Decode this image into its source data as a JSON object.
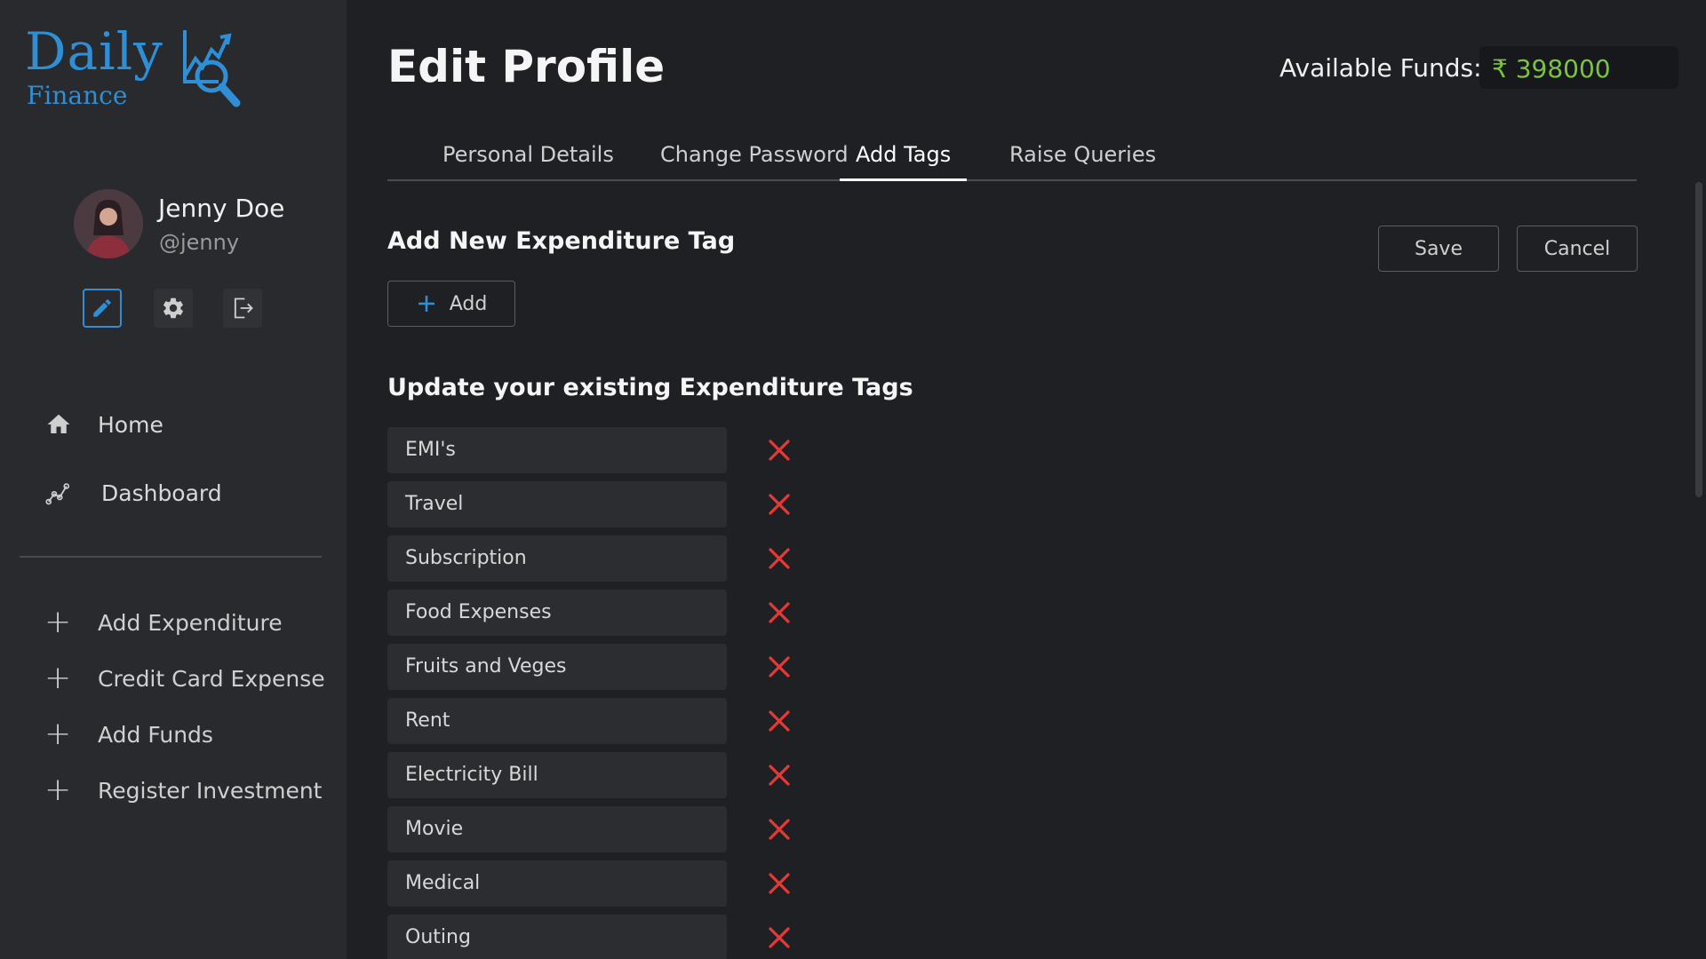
{
  "app": {
    "logo_daily": "Daily",
    "logo_finance": "Finance"
  },
  "user": {
    "name": "Jenny Doe",
    "handle": "@jenny"
  },
  "nav": {
    "home": "Home",
    "dashboard": "Dashboard"
  },
  "actions": [
    {
      "label": "Add Expenditure"
    },
    {
      "label": "Credit Card Expense"
    },
    {
      "label": "Add Funds"
    },
    {
      "label": "Register Investment"
    }
  ],
  "header": {
    "title": "Edit Profile",
    "funds_label": "Available Funds:",
    "funds_value": "₹ 398000"
  },
  "tabs": [
    {
      "label": "Personal Details"
    },
    {
      "label": "Change Password"
    },
    {
      "label": "Add Tags",
      "active": true
    },
    {
      "label": "Raise Queries"
    }
  ],
  "add_section": {
    "title": "Add New Expenditure Tag",
    "add_label": "Add",
    "save_label": "Save",
    "cancel_label": "Cancel"
  },
  "update_section": {
    "title": "Update your existing Expenditure Tags",
    "tags": [
      "EMI's",
      "Travel",
      "Subscription",
      "Food Expenses",
      "Fruits and Veges",
      "Rent",
      "Electricity Bill",
      "Movie",
      "Medical",
      "Outing"
    ]
  },
  "colors": {
    "accent": "#2f8fd6",
    "funds": "#7cc242",
    "delete": "#e53935"
  }
}
